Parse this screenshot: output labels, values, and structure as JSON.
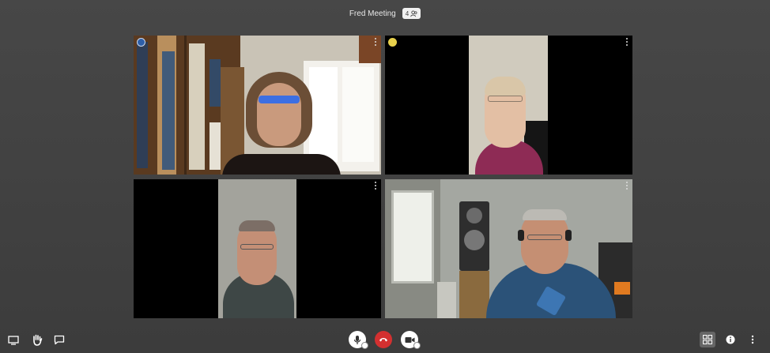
{
  "header": {
    "meeting_title": "Fred Meeting",
    "participant_count": "4"
  },
  "tiles": [
    {
      "id": "tile-1",
      "active": true,
      "speaker_badge": "blue"
    },
    {
      "id": "tile-2",
      "active": false,
      "speaker_badge": "yellow"
    },
    {
      "id": "tile-3",
      "active": false
    },
    {
      "id": "tile-4",
      "active": false
    }
  ],
  "toolbar": {
    "left": [
      "screen-share-icon",
      "raise-hand-icon",
      "chat-icon"
    ],
    "center": [
      "microphone-icon",
      "hangup-icon",
      "camera-icon"
    ],
    "right": [
      "tile-view-icon",
      "info-icon",
      "more-options-icon"
    ]
  },
  "colors": {
    "background": "#424242",
    "active_border": "#3a6fb8",
    "hangup": "#d33030",
    "speaker_yellow": "#e8d14c"
  }
}
